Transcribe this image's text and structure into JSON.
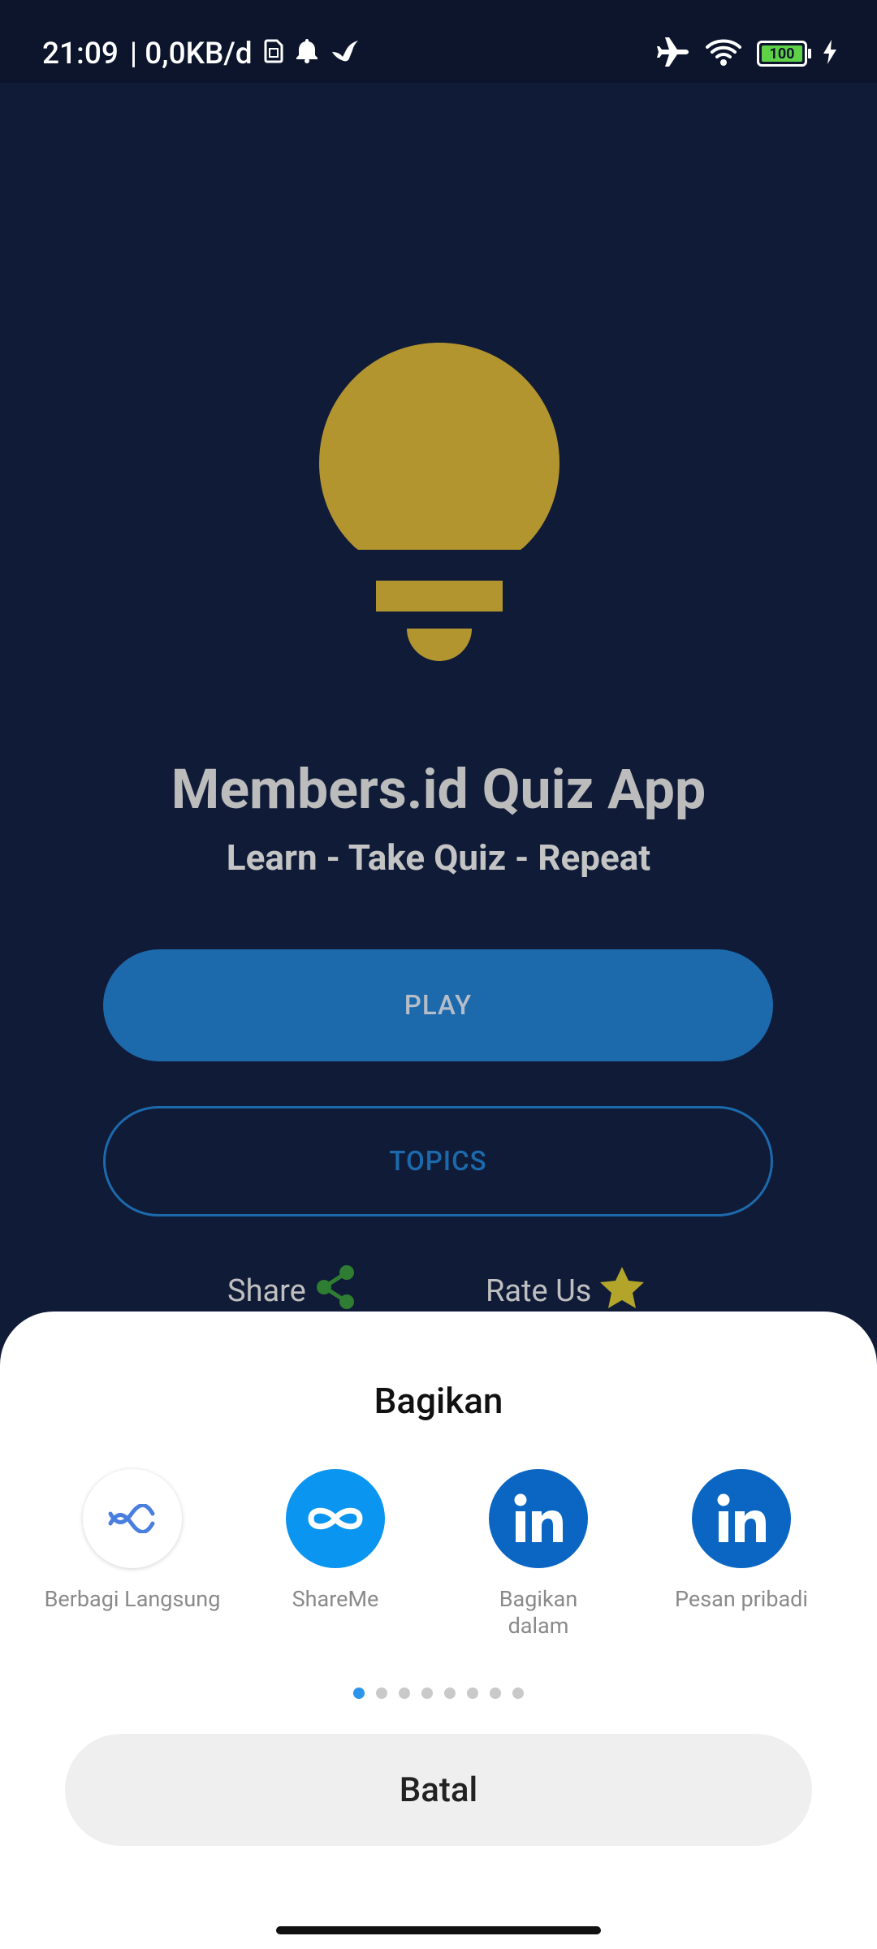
{
  "status_bar": {
    "time": "21:09",
    "network_speed": "| 0,0KB/d",
    "battery_level": "100",
    "icons": [
      "sim-icon",
      "bell-icon",
      "bird-icon",
      "airplane-icon",
      "wifi-icon",
      "battery-icon",
      "charging-icon"
    ]
  },
  "app": {
    "title": "Members.id Quiz App",
    "subtitle": "Learn - Take Quiz - Repeat",
    "play_label": "PLAY",
    "topics_label": "TOPICS",
    "share_label": "Share",
    "rate_label": "Rate Us",
    "colors": {
      "background": "#101b38",
      "bulb": "#b3952f",
      "primary": "#1c69ac",
      "share_icon": "#2e7d32",
      "star": "#b3a52a"
    }
  },
  "share_sheet": {
    "title": "Bagikan",
    "options": [
      {
        "label": "Berbagi Langsung",
        "icon": "direct-share-icon",
        "color": "#ffffff"
      },
      {
        "label": "ShareMe",
        "icon": "shareme-icon",
        "color": "#0a95f0"
      },
      {
        "label": "Bagikan dalam",
        "icon": "linkedin-icon",
        "color": "#0a66c2"
      },
      {
        "label": "Pesan pribadi",
        "icon": "linkedin-icon",
        "color": "#0a66c2"
      }
    ],
    "page_count": 8,
    "active_page": 1,
    "cancel_label": "Batal"
  }
}
